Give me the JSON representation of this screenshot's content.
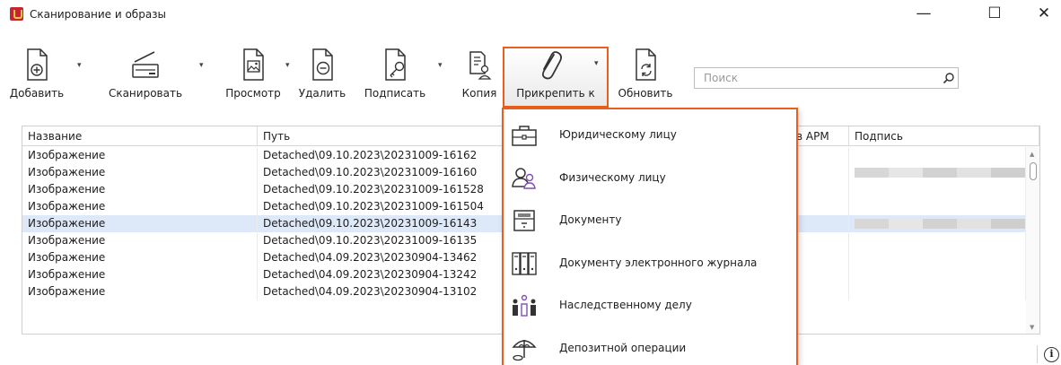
{
  "window": {
    "title": "Сканирование и образы",
    "minimize_glyph": "—",
    "maximize_glyph": "☐",
    "close_glyph": "✕"
  },
  "toolbar": {
    "add_label": "Добавить",
    "scan_label": "Сканировать",
    "view_label": "Просмотр",
    "delete_label": "Удалить",
    "sign_label": "Подписать",
    "copy_label": "Копия",
    "attach_label": "Прикрепить к",
    "refresh_label": "Обновить",
    "dropdown_glyph": "▾"
  },
  "search": {
    "placeholder": "Поиск",
    "value": ""
  },
  "table": {
    "columns": [
      "Название",
      "Путь",
      "в АРМ",
      "Подпись"
    ],
    "rows": [
      {
        "name": "Изображение",
        "path": "Detached\\09.10.2023\\20231009-16162",
        "signed": false
      },
      {
        "name": "Изображение",
        "path": "Detached\\09.10.2023\\20231009-16160",
        "signed": true
      },
      {
        "name": "Изображение",
        "path": "Detached\\09.10.2023\\20231009-161528",
        "signed": false
      },
      {
        "name": "Изображение",
        "path": "Detached\\09.10.2023\\20231009-161504",
        "signed": false
      },
      {
        "name": "Изображение",
        "path": "Detached\\09.10.2023\\20231009-16143",
        "signed": true
      },
      {
        "name": "Изображение",
        "path": "Detached\\09.10.2023\\20231009-16135",
        "signed": false
      },
      {
        "name": "Изображение",
        "path": "Detached\\04.09.2023\\20230904-13462",
        "signed": false
      },
      {
        "name": "Изображение",
        "path": "Detached\\04.09.2023\\20230904-13242",
        "signed": false
      },
      {
        "name": "Изображение",
        "path": "Detached\\04.09.2023\\20230904-13102",
        "signed": false
      }
    ],
    "selected_row_index": 4
  },
  "attach_menu": {
    "items": [
      {
        "label": "Юридическому лицу",
        "icon": "briefcase-icon"
      },
      {
        "label": "Физическому лицу",
        "icon": "persons-icon"
      },
      {
        "label": "Документу",
        "icon": "cabinet-drawer-icon"
      },
      {
        "label": "Документу электронного журнала",
        "icon": "binders-icon"
      },
      {
        "label": "Наследственному делу",
        "icon": "family-icon"
      },
      {
        "label": "Депозитной операции",
        "icon": "deposit-umbrella-icon"
      }
    ]
  },
  "status": {
    "info_glyph": "i"
  },
  "colors": {
    "accent_orange": "#e8601c",
    "selected_row": "#dde8f8",
    "arm_marker": "#7f4fb3",
    "app_icon_red": "#c4262e"
  }
}
